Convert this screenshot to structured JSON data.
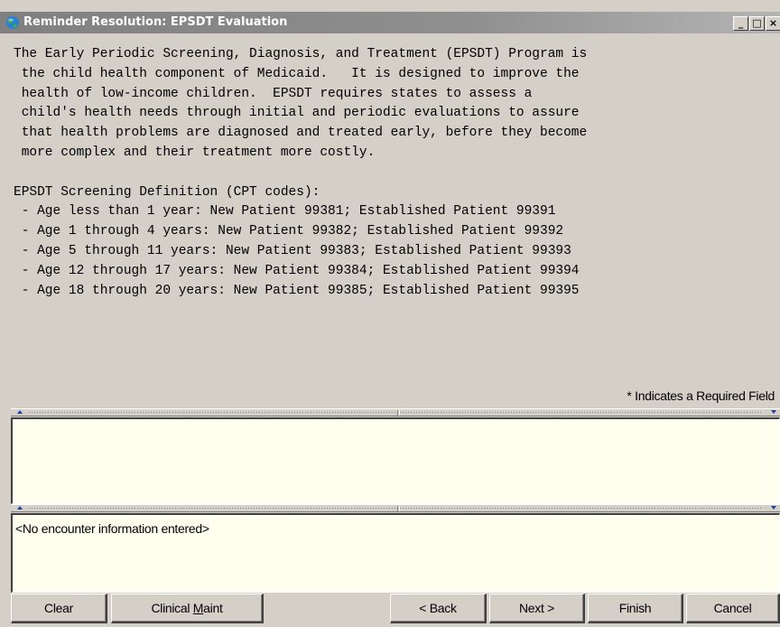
{
  "window": {
    "title": "Reminder Resolution: EPSDT Evaluation",
    "controls": {
      "minimize": "_",
      "maximize": "□",
      "close": "×"
    }
  },
  "description": {
    "lines": [
      "The Early Periodic Screening, Diagnosis, and Treatment (EPSDT) Program is",
      " the child health component of Medicaid.   It is designed to improve the",
      " health of low-income children.  EPSDT requires states to assess a",
      " child's health needs through initial and periodic evaluations to assure",
      " that health problems are diagnosed and treated early, before they become",
      " more complex and their treatment more costly.",
      "",
      "EPSDT Screening Definition (CPT codes):",
      " - Age less than 1 year: New Patient 99381; Established Patient 99391",
      " - Age 1 through 4 years: New Patient 99382; Established Patient 99392",
      " - Age 5 through 11 years: New Patient 99383; Established Patient 99393",
      " - Age 12 through 17 years: New Patient 99384; Established Patient 99394",
      " - Age 18 through 20 years: New Patient 99385; Established Patient 99395"
    ],
    "required_note": "* Indicates a Required Field"
  },
  "encounter_pane": {
    "text": "<No encounter information entered>"
  },
  "buttons": {
    "clear": "Clear",
    "clinical_maint_prefix": "Clinical ",
    "clinical_maint_accel": "M",
    "clinical_maint_suffix": "aint",
    "back": "< Back",
    "next": "Next >",
    "finish": "Finish",
    "cancel": "Cancel"
  },
  "colors": {
    "window_bg": "#d4d0c8",
    "titlebar": "#808080",
    "pane_bg": "#fffff0"
  },
  "icons": {
    "title_icon": "globe-icon"
  }
}
